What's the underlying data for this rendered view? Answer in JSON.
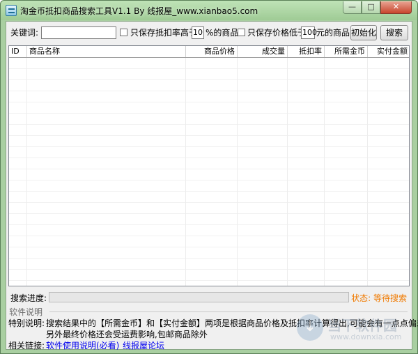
{
  "window": {
    "title": "淘金币抵扣商品搜索工具V1.1 By 线报屋_www.xianbao5.com",
    "min_glyph": "—",
    "max_glyph": "□",
    "close_glyph": "✕",
    "icons": {
      "app": "app-list-icon",
      "minimize": "minimize-icon",
      "maximize": "maximize-icon",
      "close": "close-icon"
    }
  },
  "toolbar": {
    "keyword_label": "关键词:",
    "keyword_value": "",
    "discount_check_label": "只保存抵扣率高于",
    "discount_value": "10",
    "discount_suffix": "%的商品",
    "price_check_label": "只保存价格低于",
    "price_value": "100",
    "price_suffix": "元的商品",
    "init_button": "初始化",
    "search_button": "搜索"
  },
  "table": {
    "columns": [
      "ID",
      "商品名称",
      "商品价格",
      "成交量",
      "抵扣率",
      "所需金币",
      "实付金额"
    ],
    "rows": []
  },
  "progress": {
    "label": "搜索进度:",
    "value": 0,
    "status": "状态: 等待搜索"
  },
  "help": {
    "group_title": "软件说明",
    "note_label": "特别说明:",
    "note_line1": "搜索结果中的【所需金币】和【实付金额】两项是根据商品价格及抵扣率计算得出,可能会有一点点偏差",
    "note_line2": "另外最终价格还会受运费影响,包邮商品除外",
    "links_label": "相关链接:",
    "link1": "软件使用说明(必看)",
    "link2": "线报屋论坛"
  },
  "watermark": {
    "glyph": "↓",
    "title": "当下软件园",
    "url": "www.downxia.com"
  },
  "colors": {
    "status": "#f07a00",
    "link": "#0000ee",
    "titlebar": "#a9cfa1"
  }
}
